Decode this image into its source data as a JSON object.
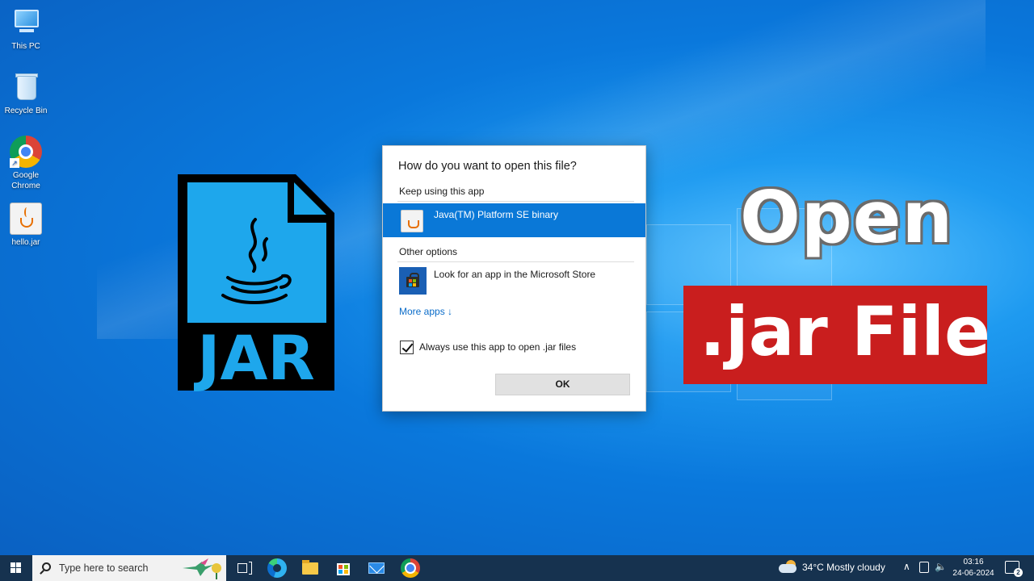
{
  "desktop": {
    "icons": [
      {
        "label": "This PC",
        "icon": "computer-icon"
      },
      {
        "label": "Recycle Bin",
        "icon": "recycle-bin-icon"
      },
      {
        "label": "Google Chrome",
        "icon": "chrome-icon"
      },
      {
        "label": "hello.jar",
        "icon": "java-jar-icon"
      }
    ]
  },
  "jar_graphic": {
    "text": "JAR",
    "icon": "java-cup-icon"
  },
  "dialog": {
    "title": "How do you want to open this file?",
    "keep_section": "Keep using this app",
    "selected_app": "Java(TM) Platform SE binary",
    "other_section": "Other options",
    "store_option": "Look for an app in the Microsoft Store",
    "more_apps": "More apps ↓",
    "checkbox_label": "Always use this app to open .jar files",
    "checkbox_checked": true,
    "ok_label": "OK"
  },
  "overlay": {
    "line1": "Open",
    "line2": ".jar File",
    "banner_color": "#c91e1e"
  },
  "taskbar": {
    "search_placeholder": "Type here to search",
    "pinned": [
      "task-view-icon",
      "edge-icon",
      "file-explorer-icon",
      "microsoft-store-icon",
      "mail-icon",
      "chrome-icon"
    ],
    "weather": "34°C  Mostly cloudy",
    "time": "03:16",
    "date": "24-06-2024",
    "notification_count": "2"
  },
  "colors": {
    "accent": "#0a78d7",
    "taskbar": "#16324f"
  }
}
